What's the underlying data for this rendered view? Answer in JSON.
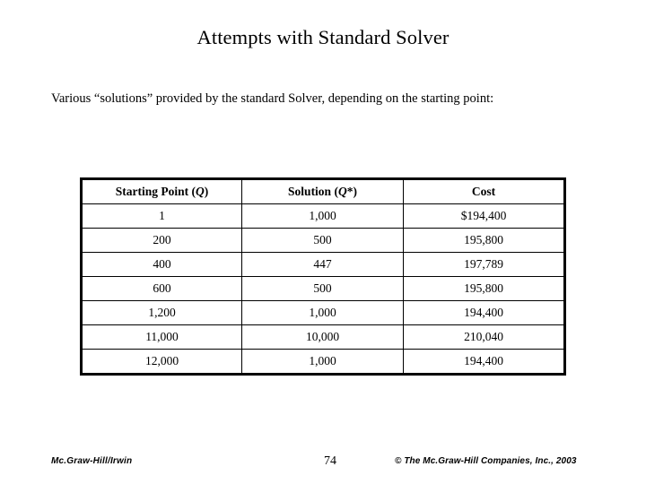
{
  "slide": {
    "title": "Attempts with Standard Solver",
    "intro": "Various “solutions” provided by the standard Solver, depending on the starting point:"
  },
  "table": {
    "headers": [
      {
        "prefix": "Starting Point (",
        "var": "Q",
        "suffix": ")"
      },
      {
        "prefix": "Solution (",
        "var": "Q",
        "suffix": "*)"
      },
      {
        "prefix": "Cost",
        "var": "",
        "suffix": ""
      }
    ],
    "header_labels": [
      "Starting Point (Q)",
      "Solution (Q*)",
      "Cost"
    ],
    "rows": [
      {
        "starting_point": "1",
        "solution": "1,000",
        "cost": "$194,400"
      },
      {
        "starting_point": "200",
        "solution": "500",
        "cost": "195,800"
      },
      {
        "starting_point": "400",
        "solution": "447",
        "cost": "197,789"
      },
      {
        "starting_point": "600",
        "solution": "500",
        "cost": "195,800"
      },
      {
        "starting_point": "1,200",
        "solution": "1,000",
        "cost": "194,400"
      },
      {
        "starting_point": "11,000",
        "solution": "10,000",
        "cost": "210,040"
      },
      {
        "starting_point": "12,000",
        "solution": "1,000",
        "cost": "194,400"
      }
    ]
  },
  "footer": {
    "left": "Mc.Graw-Hill/Irwin",
    "page_number": "74",
    "copyright": "© The Mc.Graw-Hill Companies, Inc., 2003"
  },
  "colors": {
    "background": "#ffffff",
    "text": "#000000",
    "table_border": "#000000"
  }
}
